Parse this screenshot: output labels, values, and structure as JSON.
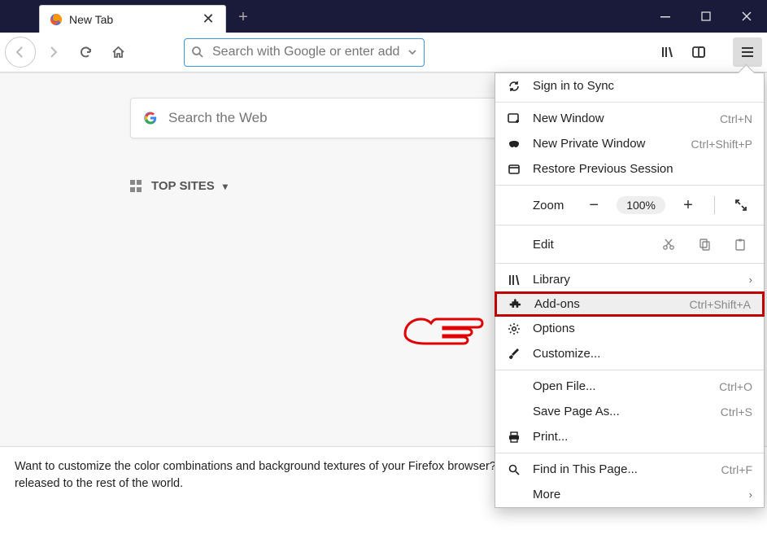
{
  "titlebar": {
    "tab_label": "New Tab"
  },
  "toolbar": {
    "url_placeholder": "Search with Google or enter address"
  },
  "content": {
    "search_placeholder": "Search the Web",
    "top_sites_label": "TOP SITES",
    "snippet": "Want to customize the color combinations and background textures of your Firefox browser? Be the first to test-drive Firefox Color before it's released to the rest of the world."
  },
  "menu": {
    "sign_in": "Sign in to Sync",
    "new_window": {
      "label": "New Window",
      "accel": "Ctrl+N"
    },
    "new_private": {
      "label": "New Private Window",
      "accel": "Ctrl+Shift+P"
    },
    "restore_session": "Restore Previous Session",
    "zoom_label": "Zoom",
    "zoom_value": "100%",
    "edit_label": "Edit",
    "library": "Library",
    "addons": {
      "label": "Add-ons",
      "accel": "Ctrl+Shift+A"
    },
    "options": "Options",
    "customize": "Customize...",
    "open_file": {
      "label": "Open File...",
      "accel": "Ctrl+O"
    },
    "save_page": {
      "label": "Save Page As...",
      "accel": "Ctrl+S"
    },
    "print": "Print...",
    "find": {
      "label": "Find in This Page...",
      "accel": "Ctrl+F"
    },
    "more": "More"
  }
}
